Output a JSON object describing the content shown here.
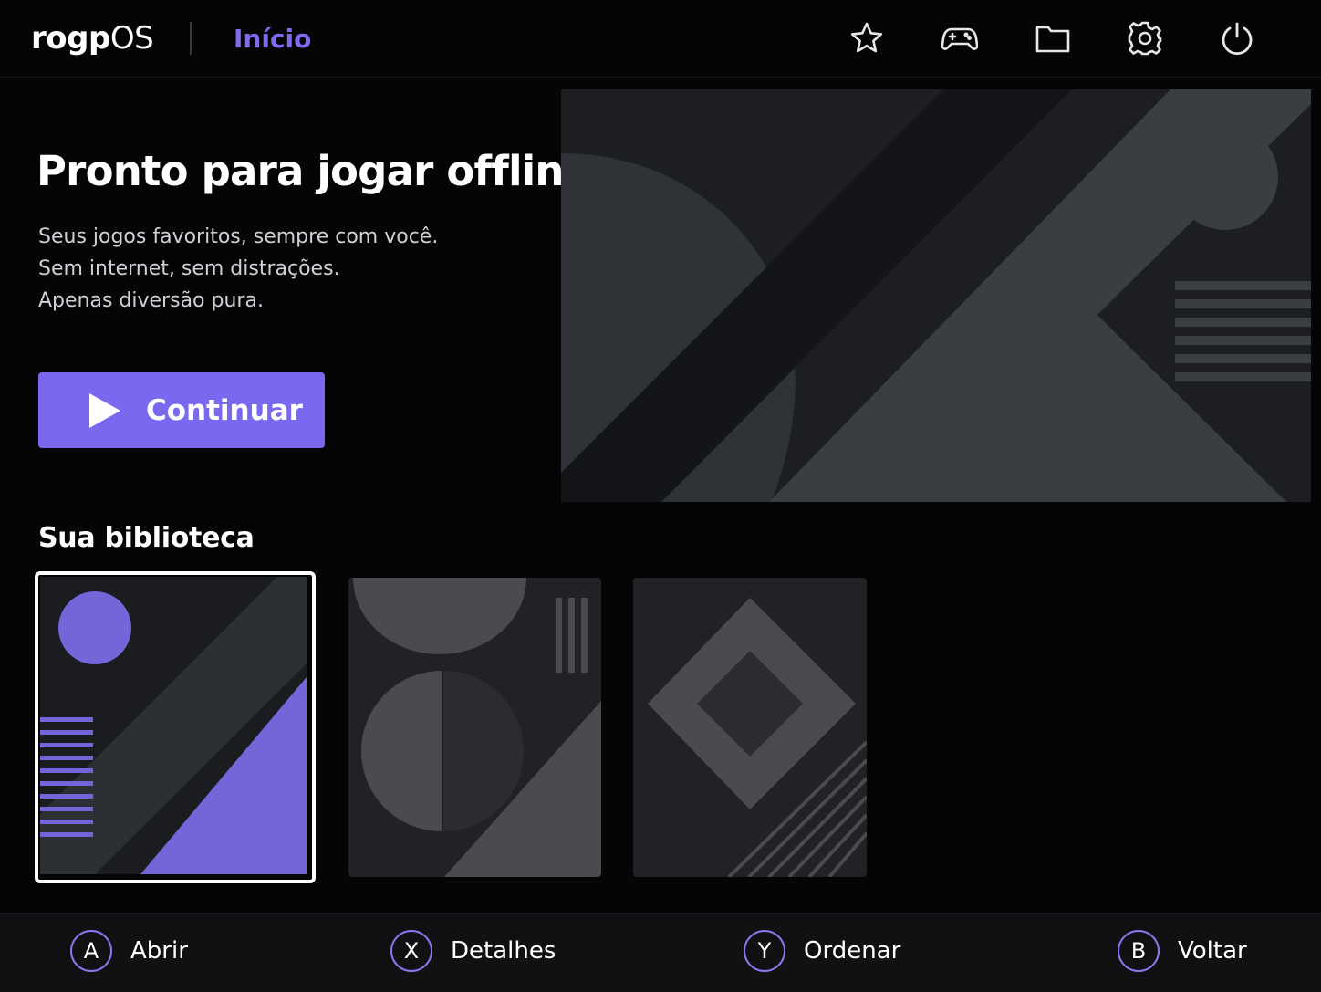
{
  "app": {
    "logo_bold": "rogp",
    "logo_light": "OS",
    "nav_active": "Início"
  },
  "topbar_icons": [
    "star-icon",
    "gamepad-icon",
    "folder-icon",
    "gear-icon",
    "power-icon"
  ],
  "hero": {
    "title": "Pronto para jogar offline",
    "lines": [
      "Seus jogos favoritos, sempre com você.",
      "Sem internet, sem distrações.",
      "Apenas diversão pura."
    ],
    "continue_label": "Continuar"
  },
  "library": {
    "title": "Sua biblioteca",
    "selected_index": 0
  },
  "hints": [
    {
      "key": "A",
      "label": "Abrir"
    },
    {
      "key": "X",
      "label": "Detalhes"
    },
    {
      "key": "Y",
      "label": "Ordenar"
    },
    {
      "key": "B",
      "label": "Voltar"
    }
  ],
  "colors": {
    "accent": "#7a68ee",
    "accent_text": "#7d6cf2",
    "background": "#050506",
    "bottom_bar": "#111114"
  }
}
